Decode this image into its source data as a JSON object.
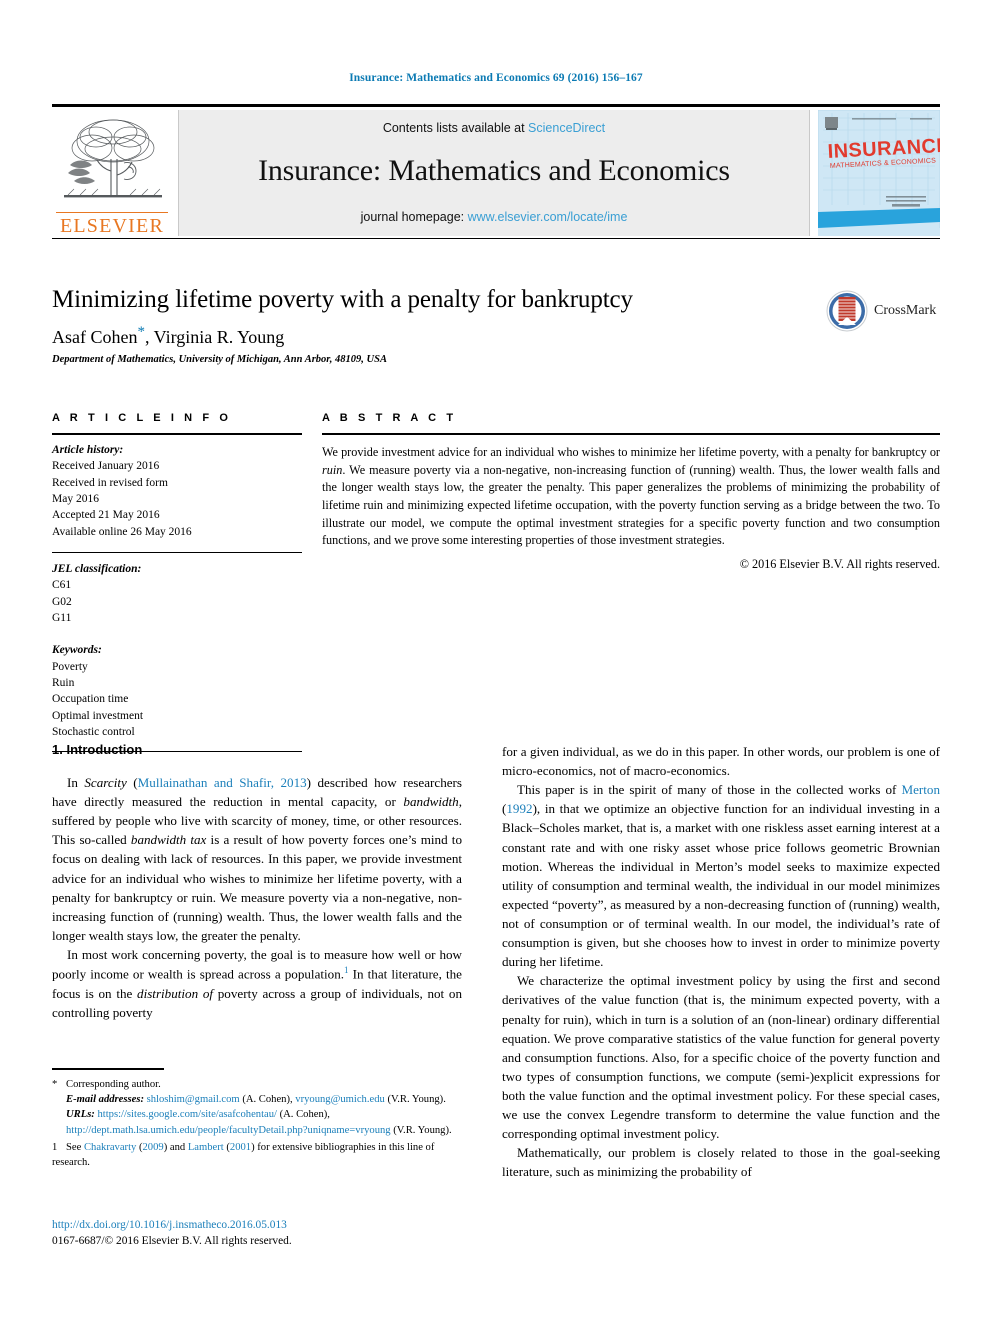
{
  "running_head": "Insurance: Mathematics and Economics 69 (2016) 156–167",
  "masthead": {
    "contents_prefix": "Contents lists available at ",
    "sciencedirect": "ScienceDirect",
    "journal_name": "Insurance: Mathematics and Economics",
    "homepage_prefix": "journal homepage: ",
    "homepage_url": "www.elsevier.com/locate/ime",
    "publisher": "ELSEVIER",
    "cover_title": "INSURANCE",
    "cover_subtitle": "MATHEMATICS & ECONOMICS",
    "link_color": "#3a9fd4",
    "publisher_color": "#E87722",
    "panel_color": "#ededed"
  },
  "title_block": {
    "title": "Minimizing lifetime poverty with a penalty for bankruptcy",
    "authors": "Asaf Cohen",
    "corresponding_marker": "*",
    "authors_rest": ", Virginia R. Young",
    "affiliation": "Department of Mathematics, University of Michigan, Ann Arbor, 48109, USA",
    "crossmark_label": "CrossMark"
  },
  "article_info": {
    "label": "A R T I C L E   I N F O",
    "history_heading": "Article history:",
    "history": [
      "Received January 2016",
      "Received in revised form",
      "May 2016",
      "Accepted 21 May 2016",
      "Available online 26 May 2016"
    ],
    "jel_heading": "JEL classification:",
    "jel_codes": [
      "C61",
      "G02",
      "G11"
    ],
    "keywords_heading": "Keywords:",
    "keywords": [
      "Poverty",
      "Ruin",
      "Occupation time",
      "Optimal investment",
      "Stochastic control"
    ]
  },
  "abstract": {
    "label": "A B S T R A C T",
    "text": "We provide investment advice for an individual who wishes to minimize her lifetime poverty, with a penalty for bankruptcy or ruin. We measure poverty via a non-negative, non-increasing function of (running) wealth. Thus, the lower wealth falls and the longer wealth stays low, the greater the penalty. This paper generalizes the problems of minimizing the probability of lifetime ruin and minimizing expected lifetime occupation, with the poverty function serving as a bridge between the two. To illustrate our model, we compute the optimal investment strategies for a specific poverty function and two consumption functions, and we prove some interesting properties of those investment strategies.",
    "italic_word": "ruin",
    "copyright": "© 2016 Elsevier B.V. All rights reserved."
  },
  "body": {
    "section_heading": "1. Introduction",
    "left_paragraphs": [
      {
        "lead": "In ",
        "italic1": "Scarcity",
        "mid1": " (",
        "ref1": "Mullainathan and Shafir, 2013",
        "mid2": ") described how researchers have directly measured the reduction in mental capacity, or ",
        "italic2": "bandwidth",
        "mid3": ", suffered by people who live with scarcity of money, time, or other resources. This so-called ",
        "italic3": "bandwidth tax",
        "tail": " is a result of how poverty forces one’s mind to focus on dealing with lack of resources. In this paper, we provide investment advice for an individual who wishes to minimize her lifetime poverty, with a penalty for bankruptcy or ruin. We measure poverty via a non-negative, non-increasing function of (running) wealth. Thus, the lower wealth falls and the longer wealth stays low, the greater the penalty."
      },
      {
        "lead": "In most work concerning poverty, the goal is to measure how well or how poorly income or wealth is spread across a population.",
        "footnote": "1",
        "mid1": " In that literature, the focus is on the ",
        "italic1": "distribution of",
        "tail": " poverty across a group of individuals, not on controlling poverty"
      }
    ],
    "right_paragraphs": [
      "for a given individual, as we do in this paper. In other words, our problem is one of micro-economics, not of macro-economics.",
      {
        "lead": "This paper is in the spirit of many of those in the collected works of ",
        "ref1": "Merton",
        "mid1": " (",
        "ref2": "1992",
        "tail": "), in that we optimize an objective function for an individual investing in a Black–Scholes market, that is, a market with one riskless asset earning interest at a constant rate and with one risky asset whose price follows geometric Brownian motion. Whereas the individual in Merton’s model seeks to maximize expected utility of consumption and terminal wealth, the individual in our model minimizes expected “poverty”, as measured by a non-decreasing function of (running) wealth, not of consumption or of terminal wealth. In our model, the individual’s rate of consumption is given, but she chooses how to invest in order to minimize poverty during her lifetime."
      },
      "We characterize the optimal investment policy by using the first and second derivatives of the value function (that is, the minimum expected poverty, with a penalty for ruin), which in turn is a solution of an (non-linear) ordinary differential equation. We prove comparative statistics of the value function for general poverty and consumption functions. Also, for a specific choice of the poverty function and two types of consumption functions, we compute (semi-)explicit expressions for both the value function and the optimal investment policy. For these special cases, we use the convex Legendre transform to determine the value function and the corresponding optimal investment policy.",
      "Mathematically, our problem is closely related to those in the goal-seeking literature, such as minimizing the probability of"
    ]
  },
  "footnotes": {
    "corresponding_marker": "*",
    "corresponding_text": "Corresponding author.",
    "email_label": "E-mail addresses:",
    "email1": "shloshim@gmail.com",
    "email1_owner": " (A. Cohen), ",
    "email2": "vryoung@umich.edu",
    "email2_owner": "(V.R. Young).",
    "urls_label": "URLs:",
    "url1": "https://sites.google.com/site/asafcohentau/",
    "url1_owner": " (A. Cohen),",
    "url2": "http://dept.math.lsa.umich.edu/people/facultyDetail.php?uniqname=vryoung",
    "url2_owner": "(V.R. Young).",
    "fn1_marker": "1",
    "fn1_prefix": "See ",
    "fn1_ref1": "Chakravarty",
    "fn1_mid1": " (",
    "fn1_ref2": "2009",
    "fn1_mid2": ") and ",
    "fn1_ref3": "Lambert",
    "fn1_mid3": " (",
    "fn1_ref4": "2001",
    "fn1_tail": ") for extensive bibliographies in this line of research."
  },
  "doi_block": {
    "doi": "http://dx.doi.org/10.1016/j.insmatheco.2016.05.013",
    "issn_copyright": "0167-6687/© 2016 Elsevier B.V. All rights reserved."
  }
}
